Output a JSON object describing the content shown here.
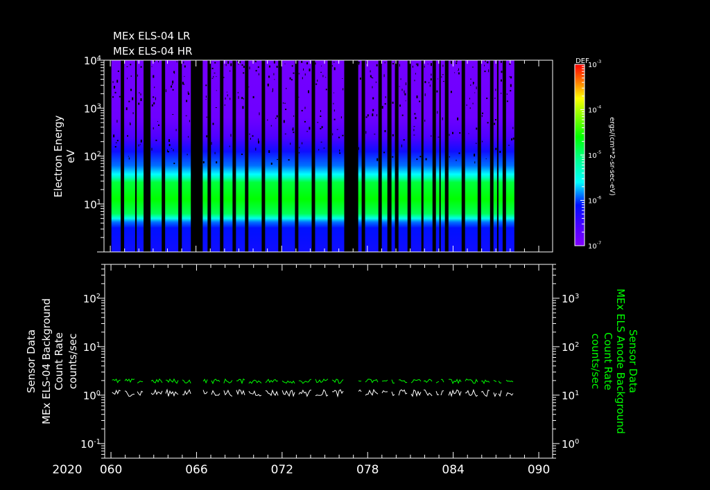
{
  "titles": [
    "MEx ELS-04 LR",
    "MEx ELS-04 HR"
  ],
  "colors": {
    "background": "#000000",
    "axis": "#ffffff",
    "secondary_series": "#00ff00",
    "primary_series": "#ffffff"
  },
  "chart_data": [
    {
      "type": "heatmap",
      "title": "MEx ELS-04 LR / HR",
      "ylabel": [
        "Electron Energy",
        "eV"
      ],
      "yscale": "log",
      "ylim": [
        1,
        10000
      ],
      "y_ticks": [
        {
          "base": "10",
          "exp": "1",
          "value": 10
        },
        {
          "base": "10",
          "exp": "2",
          "value": 100
        },
        {
          "base": "10",
          "exp": "3",
          "value": 1000
        },
        {
          "base": "10",
          "exp": "4",
          "value": 10000
        }
      ],
      "xlim": [
        59.56,
        90.97
      ],
      "x_unit": "day of year 2020",
      "colorbar": {
        "title": "DEF",
        "units": "ergs/(cm**2-sr-sec-eV)",
        "scale": "log",
        "range": [
          -7,
          -3
        ],
        "ticks": [
          {
            "base": "10",
            "exp": "-3",
            "value": -3
          },
          {
            "base": "10",
            "exp": "-4",
            "value": -4
          },
          {
            "base": "10",
            "exp": "-5",
            "value": -5
          },
          {
            "base": "10",
            "exp": "-6",
            "value": -6
          },
          {
            "base": "10",
            "exp": "-7",
            "value": -7
          }
        ],
        "colormap": [
          [
            -7,
            "#8000ff"
          ],
          [
            -6.6,
            "#5000ff"
          ],
          [
            -6.1,
            "#0010ff"
          ],
          [
            -5.6,
            "#00ffff"
          ],
          [
            -5.1,
            "#00ff90"
          ],
          [
            -4.6,
            "#00ff00"
          ],
          [
            -4.0,
            "#b0ff00"
          ],
          [
            -3.75,
            "#ffff00"
          ],
          [
            -3.4,
            "#ff8000"
          ],
          [
            -3,
            "#ff0000"
          ]
        ]
      },
      "typical_spectrum": [
        [
          0,
          -6.2
        ],
        [
          0.5,
          -6.1
        ],
        [
          0.62,
          -5.9
        ],
        [
          0.7,
          -5.5
        ],
        [
          0.8,
          -4.9
        ],
        [
          1.1,
          -4.6
        ],
        [
          1.45,
          -4.8
        ],
        [
          1.55,
          -5.3
        ],
        [
          1.62,
          -5.6
        ],
        [
          1.8,
          -5.9
        ],
        [
          2.1,
          -6.2
        ],
        [
          2.4,
          -6.6
        ],
        [
          2.8,
          -6.85
        ],
        [
          4,
          -6.9
        ]
      ],
      "data_intervals": [
        [
          60.08,
          60.73
        ],
        [
          60.97,
          61.74
        ],
        [
          61.85,
          62.33
        ],
        [
          62.82,
          63.6
        ],
        [
          63.84,
          64.76
        ],
        [
          65.01,
          65.64
        ],
        [
          66.47,
          66.81
        ],
        [
          67.05,
          67.68
        ],
        [
          67.92,
          68.56
        ],
        [
          68.8,
          69.43
        ],
        [
          69.67,
          70.6
        ],
        [
          70.84,
          71.76
        ],
        [
          72.01,
          72.93
        ],
        [
          73.17,
          74.1
        ],
        [
          74.34,
          75.22
        ],
        [
          75.51,
          76.38
        ],
        [
          77.36,
          77.6
        ],
        [
          77.84,
          78.77
        ],
        [
          79.01,
          79.4
        ],
        [
          79.69,
          79.93
        ],
        [
          80.18,
          80.81
        ],
        [
          81.05,
          81.78
        ],
        [
          81.93,
          82.56
        ],
        [
          82.8,
          83.04
        ],
        [
          83.14,
          83.43
        ],
        [
          83.68,
          84.6
        ],
        [
          84.84,
          85.72
        ],
        [
          85.96,
          86.59
        ],
        [
          86.83,
          87.08
        ],
        [
          87.18,
          87.47
        ],
        [
          87.71,
          88.29
        ]
      ]
    },
    {
      "type": "line",
      "ylabel_left": [
        "Sensor Data",
        "MEx ELS-04 Background",
        "Count Rate",
        "counts/sec"
      ],
      "ylabel_right": [
        "Sensor Data",
        "MEx ELS Anode Background",
        "Count Rate",
        "counts/sec"
      ],
      "yscale": "log",
      "ylim_left": [
        0.05,
        500
      ],
      "ylim_right": [
        0.5,
        5000
      ],
      "y_ticks_left": [
        {
          "base": "10",
          "exp": "-1",
          "value": 0.1
        },
        {
          "base": "10",
          "exp": "0",
          "value": 1
        },
        {
          "base": "10",
          "exp": "1",
          "value": 10
        },
        {
          "base": "10",
          "exp": "2",
          "value": 100
        }
      ],
      "y_ticks_right": [
        {
          "base": "10",
          "exp": "0",
          "value": 1
        },
        {
          "base": "10",
          "exp": "1",
          "value": 10
        },
        {
          "base": "10",
          "exp": "2",
          "value": 100
        },
        {
          "base": "10",
          "exp": "3",
          "value": 1000
        }
      ],
      "xlim": [
        59.56,
        90.97
      ],
      "x_ticks": [
        {
          "label": "060",
          "value": 60
        },
        {
          "label": "066",
          "value": 66
        },
        {
          "label": "072",
          "value": 72
        },
        {
          "label": "078",
          "value": 78
        },
        {
          "label": "084",
          "value": 84
        },
        {
          "label": "090",
          "value": 90
        }
      ],
      "year_label": "2020",
      "series": [
        {
          "name": "MEx ELS-04 Background",
          "axis": "left",
          "color": "#ffffff",
          "typical_value": 1.12,
          "range": [
            0.85,
            1.35
          ]
        },
        {
          "name": "MEx ELS Anode Background",
          "axis": "right",
          "color": "#00ff00",
          "typical_value": 19.5,
          "range": [
            16,
            22
          ]
        }
      ]
    }
  ]
}
